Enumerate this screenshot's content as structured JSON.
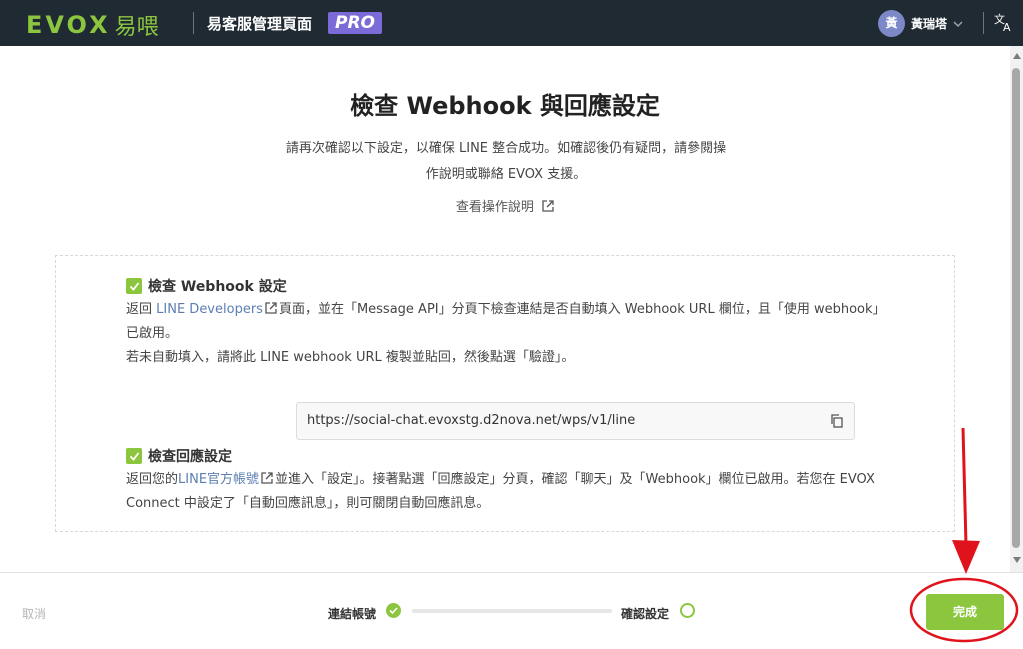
{
  "header": {
    "logo_text": "EVOX",
    "logo_cn": "易喂",
    "app_title": "易客服管理頁面",
    "pro_badge": "PRO",
    "user_initial": "黃",
    "user_name": "黃瑞塔"
  },
  "page": {
    "title": "檢查 Webhook 與回應設定",
    "description": "請再次確認以下設定，以確保 LINE 整合成功。如確認後仍有疑問，請參閱操作說明或聯絡 EVOX 支援。",
    "help_link": "查看操作說明"
  },
  "section_webhook": {
    "title": "檢查 Webhook 設定",
    "line1_prefix": "返回",
    "line1_link": "LINE Developers",
    "line1_suffix": "頁面，並在「Message API」分頁下檢查連結是否自動填入 Webhook URL 欄位，且「使用 webhook」已啟用。",
    "line2": "若未自動填入，請將此 LINE webhook URL 複製並貼回，然後點選「驗證」。",
    "webhook_url": "https://social-chat.evoxstg.d2nova.net/wps/v1/line"
  },
  "section_reply": {
    "title": "檢查回應設定",
    "line1_prefix": "返回您的",
    "line1_link": "LINE官方帳號",
    "line1_suffix": "並進入「設定」。接著點選「回應設定」分頁，確認「聊天」及「Webhook」欄位已啟用。若您在 EVOX Connect 中設定了「自動回應訊息」，則可關閉自動回應訊息。"
  },
  "footer": {
    "cancel_label": "取消",
    "step1_label": "連結帳號",
    "step2_label": "確認設定",
    "done_label": "完成"
  },
  "colors": {
    "topbar": "#1f2a33",
    "accent_green": "#8cc63f",
    "pro_purple": "#7a6bd8",
    "link_blue": "#5b7fb0",
    "annotation_red": "#e0121b"
  }
}
